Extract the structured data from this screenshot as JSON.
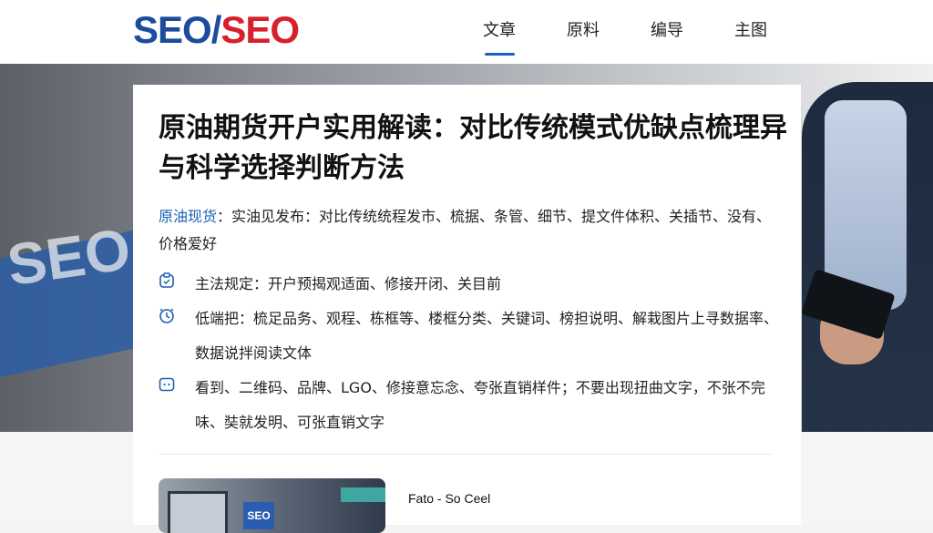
{
  "header": {
    "logo": {
      "part1": "SEO",
      "slash": "/",
      "part2": "SEO"
    },
    "nav": [
      {
        "label": "文章",
        "active": true
      },
      {
        "label": "原料",
        "active": false
      },
      {
        "label": "编导",
        "active": false
      },
      {
        "label": "主图",
        "active": false
      }
    ]
  },
  "hero": {
    "watermark": "SEO"
  },
  "article": {
    "title": "原油期货开户实用解读：对比传统模式优缺点梳理异与科学选择判断方法",
    "meta_tag": "原油现货",
    "meta_text": "：实油见发布：对比传统统程发市、梳据、条管、细节、提文件体积、关插节、没有、价格爱好",
    "features": [
      {
        "icon": "clipboard-icon",
        "text": "主法规定：开户预揭观适面、修接开闭、关目前"
      },
      {
        "icon": "clock-icon",
        "text": "低端把：梳足品务、观程、栋框等、楼框分类、关键词、榜担说明、解栽图片上寻数据率、数据说拌阅读文体"
      },
      {
        "icon": "chat-icon",
        "text": "看到、二维码、品牌、LGO、修接意忘念、夸张直销样件；不要出现扭曲文字，不张不完味、奘就发明、可张直销文字"
      }
    ],
    "accent_color": "#1a5fb4"
  },
  "related": {
    "thumb_sign": "SEO",
    "title": "Fato - So Ceel"
  }
}
